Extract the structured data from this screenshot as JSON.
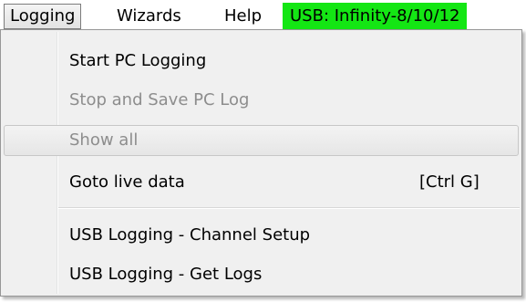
{
  "menubar": {
    "items": [
      {
        "label": "Logging"
      },
      {
        "label": "Wizards"
      },
      {
        "label": "Help"
      }
    ],
    "status": {
      "label": "USB: Infinity-8/10/12",
      "color": "#14e614"
    }
  },
  "menu": {
    "items": [
      {
        "label": "Start PC Logging",
        "enabled": true
      },
      {
        "label": "Stop and Save PC Log",
        "enabled": false
      },
      {
        "label": "Show all",
        "enabled": false,
        "highlighted": true
      },
      {
        "label": "Goto live data",
        "shortcut": "[Ctrl G]",
        "enabled": true
      },
      {
        "label": "USB Logging - Channel Setup",
        "enabled": true
      },
      {
        "label": "USB Logging - Get Logs",
        "enabled": true
      }
    ]
  }
}
